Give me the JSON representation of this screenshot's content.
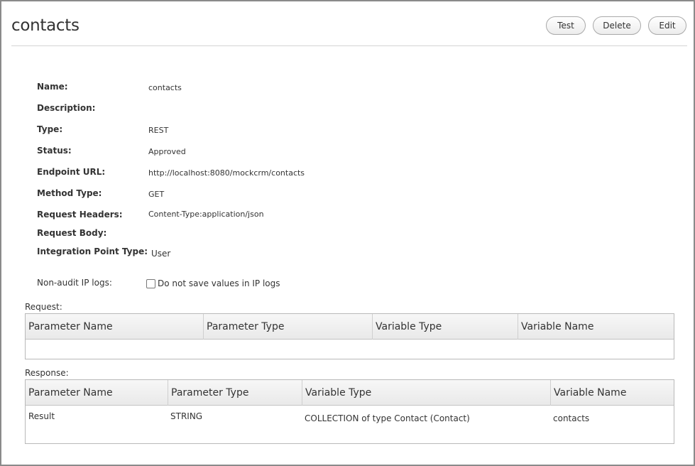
{
  "header": {
    "title": "contacts",
    "buttons": {
      "test": "Test",
      "delete": "Delete",
      "edit": "Edit"
    }
  },
  "details": {
    "name": {
      "label": "Name:",
      "value": "contacts"
    },
    "description": {
      "label": "Description:",
      "value": ""
    },
    "type": {
      "label": "Type:",
      "value": "REST"
    },
    "status": {
      "label": "Status:",
      "value": "Approved"
    },
    "endpoint_url": {
      "label": "Endpoint URL:",
      "value": "http://localhost:8080/mockcrm/contacts"
    },
    "method_type": {
      "label": "Method Type:",
      "value": "GET"
    },
    "request_headers": {
      "label": "Request Headers:",
      "value": "Content-Type:application/json"
    },
    "request_body": {
      "label": "Request Body:",
      "value": ""
    },
    "integration_point_type": {
      "label": "Integration Point Type:",
      "value": "User"
    }
  },
  "non_audit": {
    "label": "Non-audit IP logs:",
    "checkbox_label": "Do not save values in IP logs",
    "checked": false
  },
  "request": {
    "label": "Request:",
    "columns": [
      "Parameter Name",
      "Parameter Type",
      "Variable Type",
      "Variable Name"
    ],
    "rows": []
  },
  "response": {
    "label": "Response:",
    "columns": [
      "Parameter Name",
      "Parameter Type",
      "Variable Type",
      "Variable Name"
    ],
    "rows": [
      [
        "Result",
        "STRING",
        "COLLECTION of type Contact (Contact)",
        "contacts"
      ]
    ]
  }
}
